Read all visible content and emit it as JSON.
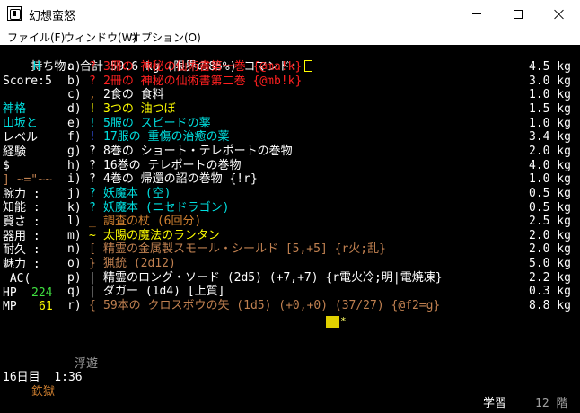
{
  "window": {
    "title": "幻想蛮怒",
    "buttons": {
      "minimize": "—",
      "maximize": "☐",
      "close": "✕"
    }
  },
  "menu": [
    "ファイル(F)",
    "ウィンドウ(W)",
    "オプション(O)"
  ],
  "header": {
    "prefix": "持ち物: ",
    "total_label": "合計 ",
    "total_value": "59.6 kg",
    "limit": "(限界の85%)",
    "command": "コマンド: "
  },
  "colors": {
    "red": "#ff2020",
    "white": "#ffffff",
    "yellow": "#ffff00",
    "cyan": "#00e0e0",
    "blue": "#3b5cff",
    "orange": "#d08030",
    "brown": "#c08050",
    "lightgray": "#c0c0c0",
    "green": "#40e040",
    "gray": "#a0a0a0"
  },
  "sidebar": {
    "race_symbol": "H",
    "score": "Score:5",
    "class": "神格",
    "realm1": "山坂と",
    "level_label": "レベル",
    "exp_label": "経験",
    "gold_label": "$",
    "equip_chars": "] ~=\"~~",
    "stats": [
      {
        "label": "腕力 :",
        "value": ""
      },
      {
        "label": "知能 :",
        "value": ""
      },
      {
        "label": "賢さ :",
        "value": ""
      },
      {
        "label": "器用 :",
        "value": ""
      },
      {
        "label": "耐久 :",
        "value": ""
      },
      {
        "label": "魅力 :",
        "value": ""
      }
    ],
    "ac_label": " AC(",
    "hp_label": "HP",
    "hp_value": "224",
    "mp_label": "MP",
    "mp_value": "61"
  },
  "inventory": [
    {
      "slot": "a)",
      "sym": "?",
      "sym_color": "red",
      "name": "3冊の 神秘の仙術書第一巻 {@ma!k}",
      "name_color": "red",
      "weight": "4.5 kg"
    },
    {
      "slot": "b)",
      "sym": "?",
      "sym_color": "red",
      "name": "2冊の 神秘の仙術書第二巻 {@mb!k}",
      "name_color": "red",
      "weight": "3.0 kg"
    },
    {
      "slot": "c)",
      "sym": ",",
      "sym_color": "orange",
      "name": "2食の 食料",
      "name_color": "white",
      "weight": "1.0 kg"
    },
    {
      "slot": "d)",
      "sym": "!",
      "sym_color": "yellow",
      "name": "3つの 油つぼ",
      "name_color": "yellow",
      "weight": "1.5 kg"
    },
    {
      "slot": "e)",
      "sym": "!",
      "sym_color": "cyan",
      "name": "5服の スピードの薬",
      "name_color": "cyan",
      "weight": "1.0 kg"
    },
    {
      "slot": "f)",
      "sym": "!",
      "sym_color": "blue",
      "name": "17服の 重傷の治癒の薬",
      "name_color": "cyan",
      "weight": "3.4 kg"
    },
    {
      "slot": "g)",
      "sym": "?",
      "sym_color": "white",
      "name": "8巻の ショート・テレポートの巻物",
      "name_color": "white",
      "weight": "2.0 kg"
    },
    {
      "slot": "h)",
      "sym": "?",
      "sym_color": "white",
      "name": "16巻の テレポートの巻物",
      "name_color": "white",
      "weight": "4.0 kg"
    },
    {
      "slot": "i)",
      "sym": "?",
      "sym_color": "white",
      "name": "4巻の 帰還の詔の巻物 {!r}",
      "name_color": "white",
      "weight": "1.0 kg"
    },
    {
      "slot": "j)",
      "sym": "?",
      "sym_color": "cyan",
      "name": "妖魔本 (空)",
      "name_color": "cyan",
      "weight": "0.5 kg"
    },
    {
      "slot": "k)",
      "sym": "?",
      "sym_color": "cyan",
      "name": "妖魔本 (ニセドラゴン)",
      "name_color": "cyan",
      "weight": "0.5 kg"
    },
    {
      "slot": "l)",
      "sym": "_",
      "sym_color": "orange",
      "name": "調査の杖 (6回分)",
      "name_color": "orange",
      "weight": "2.5 kg"
    },
    {
      "slot": "m)",
      "sym": "~",
      "sym_color": "yellow",
      "name": "太陽の魔法のランタン",
      "name_color": "yellow",
      "weight": "2.0 kg"
    },
    {
      "slot": "n)",
      "sym": "[",
      "sym_color": "brown",
      "name": "精霊の金属製スモール・シールド [5,+5] {r火;乱}",
      "name_color": "brown",
      "weight": "2.0 kg"
    },
    {
      "slot": "o)",
      "sym": "}",
      "sym_color": "brown",
      "name": "猟銃 (2d12)",
      "name_color": "brown",
      "weight": "5.0 kg"
    },
    {
      "slot": "p)",
      "sym": "|",
      "sym_color": "lightgray",
      "name": "精霊のロング・ソード (2d5) (+7,+7) {r電火冷;明|電焼凍}",
      "name_color": "white",
      "weight": "2.2 kg"
    },
    {
      "slot": "q)",
      "sym": "|",
      "sym_color": "lightgray",
      "name": "ダガー (1d4) [上質]",
      "name_color": "white",
      "weight": "0.3 kg"
    },
    {
      "slot": "r)",
      "sym": "{",
      "sym_color": "brown",
      "name": "59本の クロスボウの矢 (1d5) (+0,+0) (37/27) {@f2=g}",
      "name_color": "brown",
      "weight": "8.8 kg"
    }
  ],
  "status": {
    "floating": "浮遊",
    "day": "16日目  1:36",
    "terrain": "鉄獄",
    "study": "学習",
    "depth": "12 階"
  }
}
